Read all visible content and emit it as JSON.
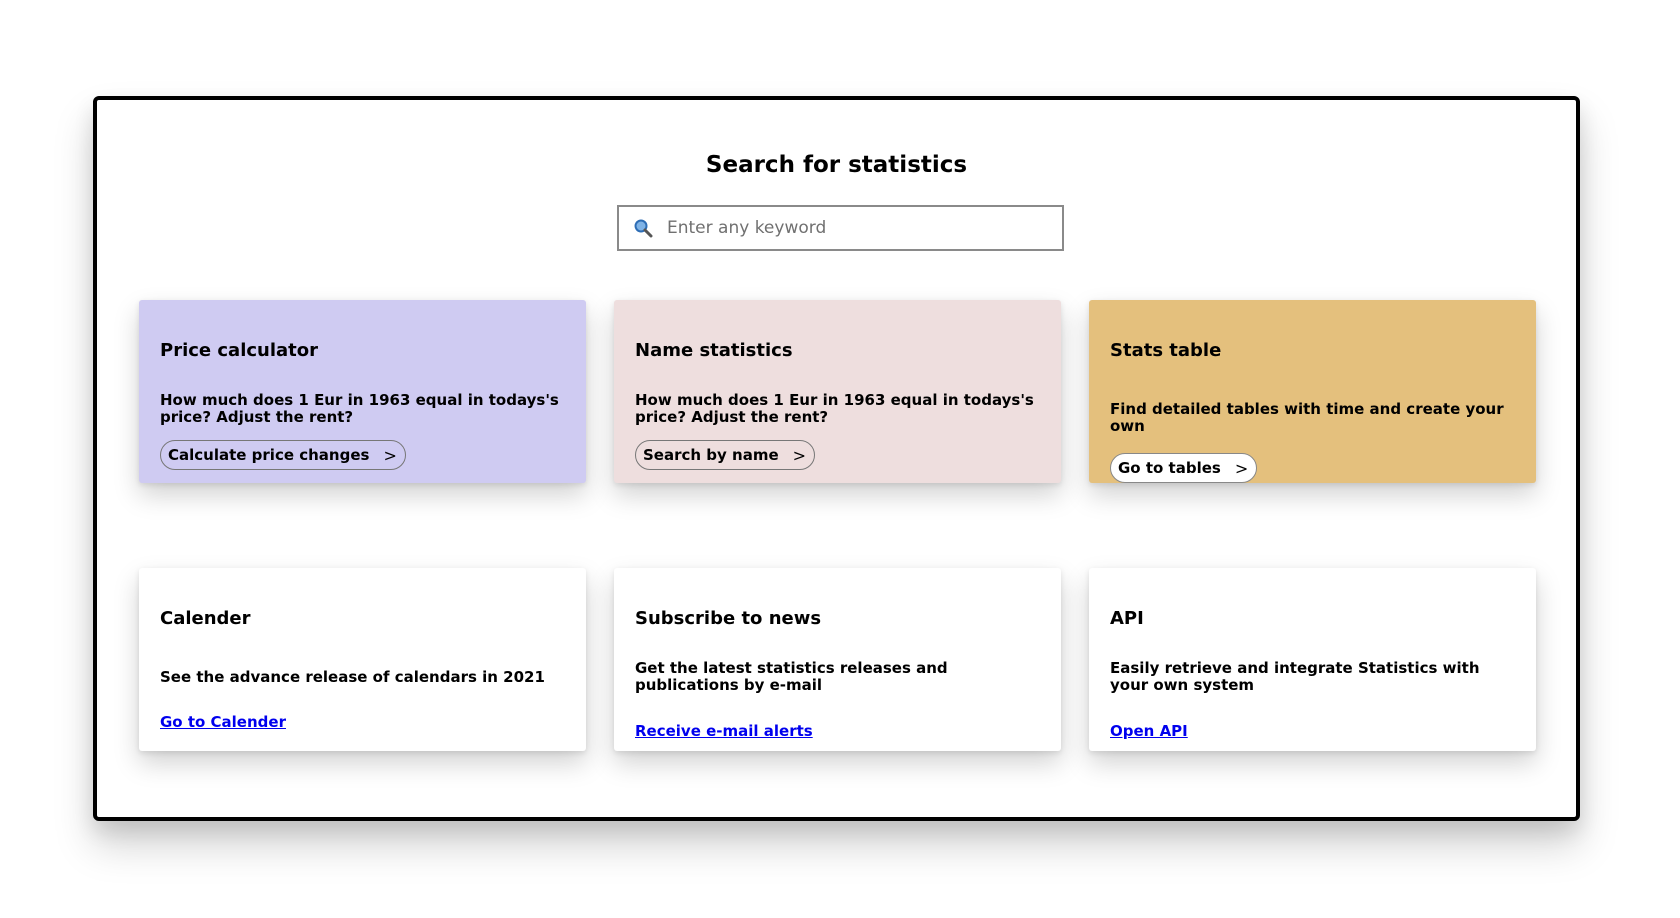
{
  "page": {
    "title": "Search for statistics"
  },
  "search": {
    "placeholder": "Enter any keyword",
    "icon": "search-icon"
  },
  "cards": [
    {
      "title": "Price calculator",
      "description": "How much does 1 Eur in 1963 equal in todays's price? Adjust the rent?",
      "action_label": "Calculate price changes",
      "action_icon": ">",
      "color": "#cfcbf2"
    },
    {
      "title": "Name statistics",
      "description": "How much does 1 Eur in 1963 equal in todays's price? Adjust the rent?",
      "action_label": "Search by name",
      "action_icon": ">",
      "color": "#eedede"
    },
    {
      "title": "Stats table",
      "description": "Find detailed tables with time and create your own",
      "action_label": "Go to tables",
      "action_icon": ">",
      "color": "#e4c07d"
    },
    {
      "title": "Calender",
      "description": "See the advance release of calendars in 2021",
      "action_label": "Go to Calender",
      "color": "#ffffff"
    },
    {
      "title": "Subscribe to news",
      "description": "Get the latest statistics releases and publications by e-mail",
      "action_label": "Receive e-mail alerts",
      "color": "#ffffff"
    },
    {
      "title": "API",
      "description": "Easily retrieve and integrate Statistics with your own system",
      "action_label": "Open API",
      "color": "#ffffff"
    }
  ],
  "colors": {
    "link": "#0000ee",
    "frame_border": "#000000"
  }
}
